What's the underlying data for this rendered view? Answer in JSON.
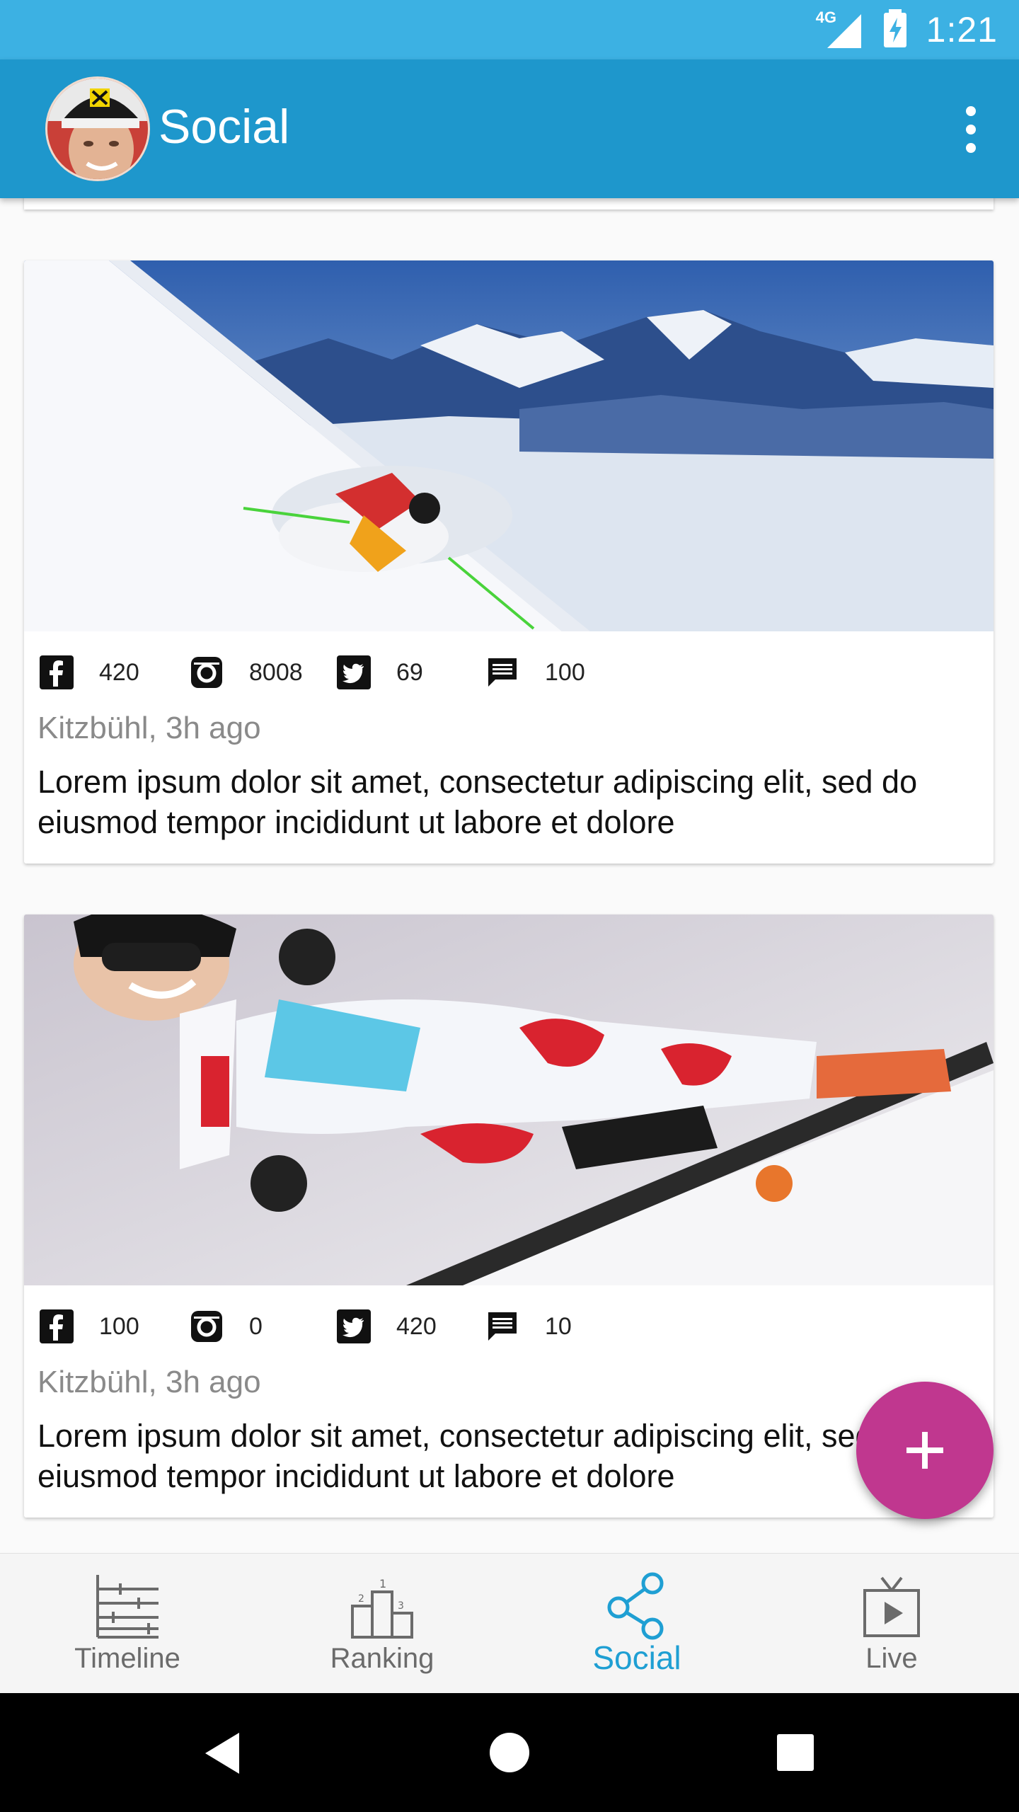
{
  "status_bar": {
    "time": "1:21",
    "network": "4G",
    "icons": [
      "signal-icon",
      "battery-charging-icon"
    ]
  },
  "app_bar": {
    "title": "Social",
    "avatar_icon": "user-avatar",
    "menu_icon": "more-vert-icon"
  },
  "colors": {
    "status_bar": "#3cb1e3",
    "app_bar": "#1e97cc",
    "fab": "#c0378f",
    "active_tab": "#1f9fd3"
  },
  "posts": [
    {
      "image": "skier-in-powder-mountains",
      "stats": {
        "facebook": "420",
        "instagram": "8008",
        "twitter": "69",
        "comments": "100"
      },
      "location_time": "Kitzbühl, 3h ago",
      "text": "Lorem ipsum dolor sit amet, consectetur adipiscing elit, sed do eiusmod tempor incididunt ut labore et dolore"
    },
    {
      "image": "alpine-racer-giant-slalom",
      "stats": {
        "facebook": "100",
        "instagram": "0",
        "twitter": "420",
        "comments": "10"
      },
      "location_time": "Kitzbühl, 3h ago",
      "text": "Lorem ipsum dolor sit amet, consectetur adipiscing elit, sed do eiusmod tempor incididunt ut labore et dolore"
    }
  ],
  "fab": {
    "icon": "plus-icon"
  },
  "bottom_nav": [
    {
      "label": "Timeline",
      "icon": "timeline-icon",
      "active": false
    },
    {
      "label": "Ranking",
      "icon": "podium-icon",
      "active": false
    },
    {
      "label": "Social",
      "icon": "share-icon",
      "active": true
    },
    {
      "label": "Live",
      "icon": "tv-play-icon",
      "active": false
    }
  ],
  "system_nav": [
    "back-icon",
    "home-icon",
    "recents-icon"
  ]
}
